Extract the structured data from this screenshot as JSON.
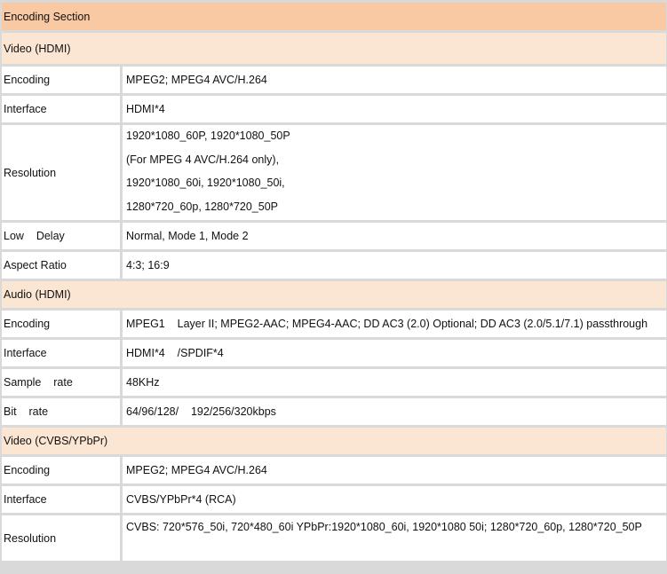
{
  "sections": {
    "encoding_section": "Encoding Section",
    "video_hdmi": "Video (HDMI)",
    "audio_hdmi": "Audio (HDMI)",
    "video_cvbs": "Video (CVBS/YPbPr)"
  },
  "video_hdmi": {
    "encoding": {
      "label": "Encoding",
      "value": "MPEG2; MPEG4 AVC/H.264"
    },
    "interface": {
      "label": "Interface",
      "value": "HDMI*4"
    },
    "resolution": {
      "label": "Resolution",
      "lines": [
        "1920*1080_60P, 1920*1080_50P",
        "(For    MPEG 4 AVC/H.264 only),",
        "1920*1080_60i, 1920*1080_50i,",
        "1280*720_60p, 1280*720_50P"
      ]
    },
    "low_delay": {
      "label": "Low    Delay",
      "value": "Normal, Mode 1, Mode 2"
    },
    "aspect_ratio": {
      "label": "Aspect Ratio",
      "value": "4:3; 16:9"
    }
  },
  "audio_hdmi": {
    "encoding": {
      "label": "Encoding",
      "value": "MPEG1    Layer II; MPEG2-AAC; MPEG4-AAC; DD AC3 (2.0) Optional; DD AC3 (2.0/5.1/7.1) passthrough"
    },
    "interface": {
      "label": "Interface",
      "value": "HDMI*4    /SPDIF*4"
    },
    "sample_rate": {
      "label": "Sample    rate",
      "value": "48KHz"
    },
    "bit_rate": {
      "label": "Bit    rate",
      "value": "64/96/128/    192/256/320kbps"
    }
  },
  "video_cvbs": {
    "encoding": {
      "label": "Encoding",
      "value": "MPEG2; MPEG4 AVC/H.264"
    },
    "interface": {
      "label": "Interface",
      "value": "CVBS/YPbPr*4 (RCA)"
    },
    "resolution": {
      "label": "Resolution",
      "value": "CVBS: 720*576_50i, 720*480_60i YPbPr:1920*1080_60i, 1920*1080 50i; 1280*720_60p, 1280*720_50P"
    }
  }
}
